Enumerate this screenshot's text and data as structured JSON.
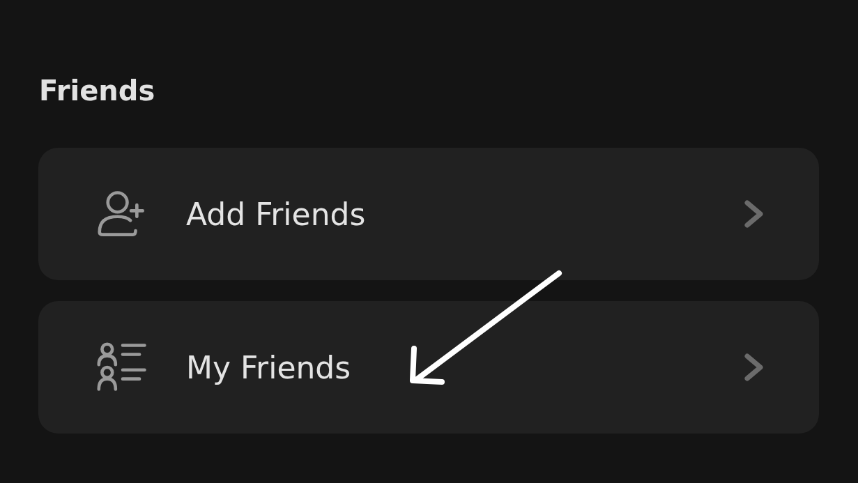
{
  "section": {
    "title": "Friends"
  },
  "items": [
    {
      "kind": "add",
      "label": "Add Friends"
    },
    {
      "kind": "list",
      "label": "My Friends"
    }
  ]
}
